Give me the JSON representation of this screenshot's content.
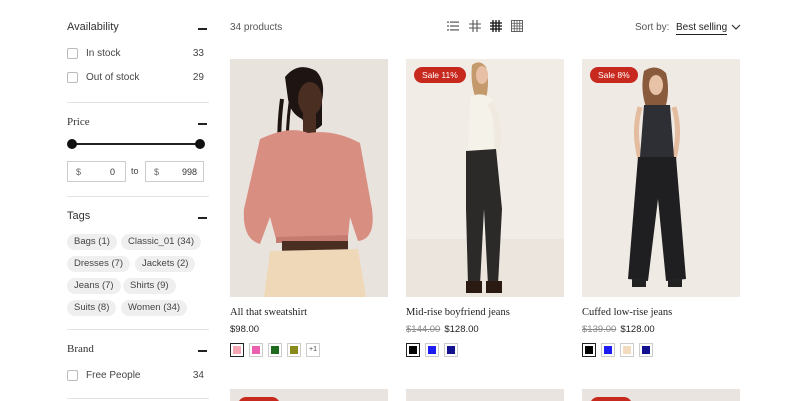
{
  "filters": {
    "availability": {
      "title": "Availability",
      "options": [
        {
          "label": "In stock",
          "count": "33"
        },
        {
          "label": "Out of stock",
          "count": "29"
        }
      ]
    },
    "price": {
      "title": "Price",
      "currency": "$",
      "min": "0",
      "max": "998",
      "to_label": "to"
    },
    "tags": {
      "title": "Tags",
      "items": [
        "Bags (1)",
        "Classic_01 (34)",
        "Dresses (7)",
        "Jackets (2)",
        "Jeans (7)",
        "Shirts (9)",
        "Suits (8)",
        "Women (34)"
      ]
    },
    "brand": {
      "title": "Brand",
      "options": [
        {
          "label": "Free People",
          "count": "34"
        }
      ]
    }
  },
  "toolbar": {
    "product_count": "34 products",
    "sort_label": "Sort by:",
    "sort_value": "Best selling"
  },
  "products": [
    {
      "title": "All that sweatshirt",
      "price": "$98.00",
      "old_price": "",
      "badge": "",
      "swatches": [
        "#f4a6b5",
        "#ec5fb0",
        "#1e6b1e",
        "#8a8a1c"
      ],
      "more": "+1"
    },
    {
      "title": "Mid-rise boyfriend jeans",
      "price": "$128.00",
      "old_price": "$144.00",
      "badge": "Sale 11%",
      "swatches": [
        "#000000",
        "#1c1cf0",
        "#12128f"
      ],
      "more": ""
    },
    {
      "title": "Cuffed low-rise jeans",
      "price": "$128.00",
      "old_price": "$139.00",
      "badge": "Sale 8%",
      "swatches": [
        "#000000",
        "#1c1cf0",
        "#f1dcc0",
        "#12128f"
      ],
      "more": ""
    }
  ],
  "colors": {
    "sale_badge": "#c8291f",
    "accent": "#222222"
  }
}
